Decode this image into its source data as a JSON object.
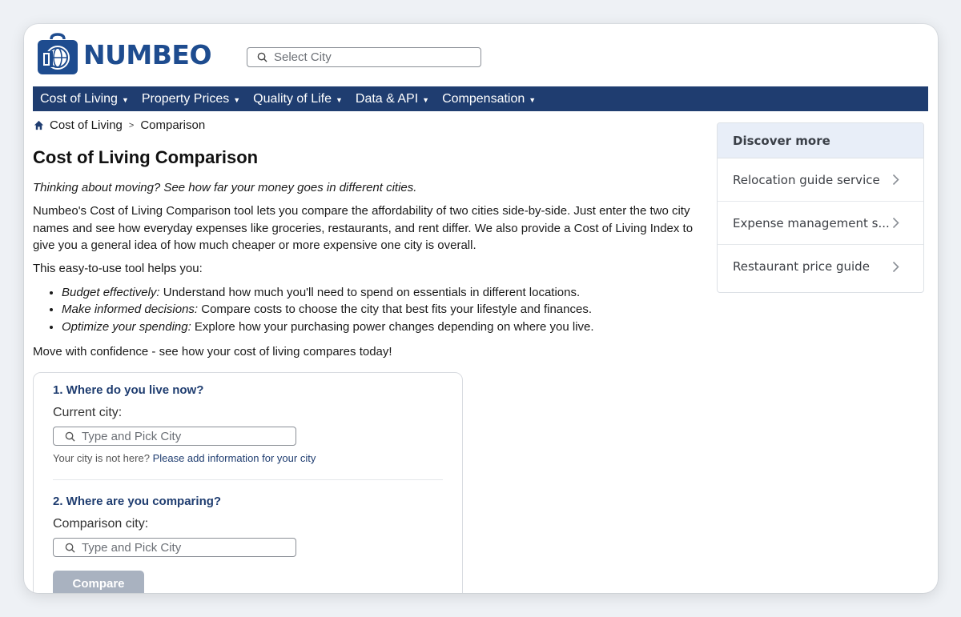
{
  "brand": {
    "name": "NUMBEO"
  },
  "search": {
    "placeholder": "Select City"
  },
  "nav": {
    "items": [
      {
        "label": "Cost of Living"
      },
      {
        "label": "Property Prices"
      },
      {
        "label": "Quality of Life"
      },
      {
        "label": "Data & API"
      },
      {
        "label": "Compensation"
      }
    ]
  },
  "breadcrumb": {
    "items": [
      "Cost of Living",
      "Comparison"
    ],
    "separator": ">"
  },
  "main": {
    "title": "Cost of Living Comparison",
    "tagline": "Thinking about moving? See how far your money goes in different cities.",
    "intro": "Numbeo's Cost of Living Comparison tool lets you compare the affordability of two cities side-by-side. Just enter the two city names and see how everyday expenses like groceries, restaurants, and rent differ. We also provide a Cost of Living Index to give you a general idea of how much cheaper or more expensive one city is overall.",
    "helps": "This easy-to-use tool helps you:",
    "bullets": [
      {
        "term": "Budget effectively:",
        "text": " Understand how much you'll need to spend on essentials in different locations."
      },
      {
        "term": "Make informed decisions:",
        "text": " Compare costs to choose the city that best fits your lifestyle and finances."
      },
      {
        "term": "Optimize your spending:",
        "text": " Explore how your purchasing power changes depending on where you live."
      }
    ],
    "closing": "Move with confidence - see how your cost of living compares today!"
  },
  "form": {
    "step1_title": "1. Where do you live now?",
    "current_label": "Current city:",
    "current_placeholder": "Type and Pick City",
    "not_here_text": "Your city is not here?",
    "not_here_link": "Please add information for your city",
    "step2_title": "2. Where are you comparing?",
    "comparison_label": "Comparison city:",
    "comparison_placeholder": "Type and Pick City",
    "compare_button": "Compare"
  },
  "sidebar": {
    "title": "Discover more",
    "items": [
      {
        "label": "Relocation guide service"
      },
      {
        "label": "Expense management s..."
      },
      {
        "label": "Restaurant price guide"
      }
    ]
  },
  "colors": {
    "nav_bg": "#1f3d70",
    "brand": "#1e4c8f",
    "sidebar_header_bg": "#e8eef8",
    "compare_button_bg": "#a9b2c0"
  },
  "icons": [
    "bag-logo-icon",
    "search-icon",
    "caret-down-icon",
    "home-icon",
    "chevron-right-icon"
  ]
}
